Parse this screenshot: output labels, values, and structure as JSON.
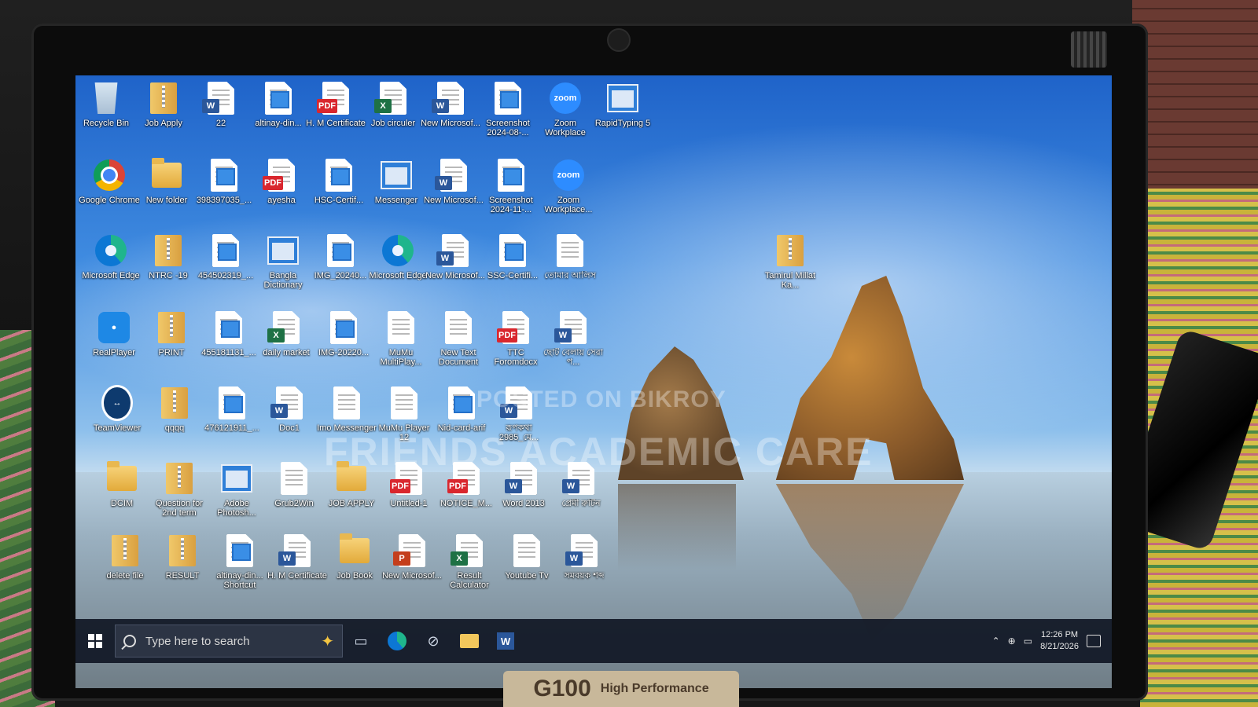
{
  "desktop": {
    "icons": [
      {
        "label": "Recycle Bin",
        "type": "recycle"
      },
      {
        "label": "Job Apply",
        "type": "zip"
      },
      {
        "label": "22",
        "type": "word"
      },
      {
        "label": "altinay-din...",
        "type": "img"
      },
      {
        "label": "H. M Certificate",
        "type": "pdf"
      },
      {
        "label": "Job circuler",
        "type": "excel"
      },
      {
        "label": "New Microsof...",
        "type": "word"
      },
      {
        "label": "Screenshot 2024-08-...",
        "type": "img"
      },
      {
        "label": "Zoom Workplace",
        "type": "zoom"
      },
      {
        "label": "RapidTyping 5",
        "type": "window"
      },
      {
        "label": "Google Chrome",
        "type": "chrome"
      },
      {
        "label": "New folder",
        "type": "folder"
      },
      {
        "label": "398397035_...",
        "type": "img"
      },
      {
        "label": "ayesha",
        "type": "pdf"
      },
      {
        "label": "HSC-Certif...",
        "type": "img"
      },
      {
        "label": "Messenger",
        "type": "window"
      },
      {
        "label": "New Microsof...",
        "type": "word"
      },
      {
        "label": "Screenshot 2024-11-...",
        "type": "img"
      },
      {
        "label": "Zoom Workplace...",
        "type": "zoom"
      },
      {
        "label": "Microsoft Edge",
        "type": "edge"
      },
      {
        "label": "NTRC -19",
        "type": "zip"
      },
      {
        "label": "454502319_...",
        "type": "img"
      },
      {
        "label": "Bangla Dictionary",
        "type": "window"
      },
      {
        "label": "IMG_20240...",
        "type": "img"
      },
      {
        "label": "Microsoft Edge",
        "type": "edge"
      },
      {
        "label": "New Microsof...",
        "type": "word"
      },
      {
        "label": "SSC-Certifi...",
        "type": "img"
      },
      {
        "label": "তোমার আলিস",
        "type": "doc"
      },
      {
        "label": "Tamirul Millat Ka...",
        "type": "zip"
      },
      {
        "label": "RealPlayer",
        "type": "real"
      },
      {
        "label": "PRINT",
        "type": "zip"
      },
      {
        "label": "455181131_...",
        "type": "img"
      },
      {
        "label": "daily market",
        "type": "excel"
      },
      {
        "label": "IMG-20220...",
        "type": "img"
      },
      {
        "label": "MuMu MultiPlay...",
        "type": "doc"
      },
      {
        "label": "New Text Document",
        "type": "doc"
      },
      {
        "label": "TTC Foromdocx",
        "type": "pdf"
      },
      {
        "label": "ছোট বেলায় সেরা প...",
        "type": "word"
      },
      {
        "label": "TeamViewer",
        "type": "tv"
      },
      {
        "label": "qqqq",
        "type": "zip"
      },
      {
        "label": "476121911_...",
        "type": "img"
      },
      {
        "label": "Doc1",
        "type": "word"
      },
      {
        "label": "Imo Messenger",
        "type": "doc"
      },
      {
        "label": "MuMu Player 12",
        "type": "doc"
      },
      {
        "label": "Nid-card-arif",
        "type": "img"
      },
      {
        "label": "রূপকথা 2985_মে...",
        "type": "word"
      },
      {
        "label": "DCIM",
        "type": "folder"
      },
      {
        "label": "Question for 2nd term",
        "type": "zip"
      },
      {
        "label": "Adobe Photosh...",
        "type": "window"
      },
      {
        "label": "Grub2Win",
        "type": "doc"
      },
      {
        "label": "JOB APPLY",
        "type": "folder"
      },
      {
        "label": "Untitled-1",
        "type": "pdf"
      },
      {
        "label": "NOTICE_M...",
        "type": "pdf"
      },
      {
        "label": "Word 2013",
        "type": "word"
      },
      {
        "label": "প্রেমী রুটিন",
        "type": "word"
      },
      {
        "label": "delete file",
        "type": "zip"
      },
      {
        "label": "RESULT",
        "type": "zip"
      },
      {
        "label": "altinay-din... Shortcut",
        "type": "img"
      },
      {
        "label": "H. M Certificate",
        "type": "word"
      },
      {
        "label": "Job Book",
        "type": "folder"
      },
      {
        "label": "New Microsof...",
        "type": "ppt"
      },
      {
        "label": "Result Calculator",
        "type": "excel"
      },
      {
        "label": "Youtube Tv",
        "type": "doc"
      },
      {
        "label": "সমবয়ক শব্দ",
        "type": "word"
      }
    ]
  },
  "watermark": {
    "line1": "POSTED ON BIKROY",
    "line2": "FRIENDS ACADEMIC CARE"
  },
  "taskbar": {
    "search_placeholder": "Type here to search",
    "time": "12:26 PM",
    "date": "8/21/2026"
  },
  "sticker": {
    "model": "G100",
    "tag": "High Performance"
  }
}
